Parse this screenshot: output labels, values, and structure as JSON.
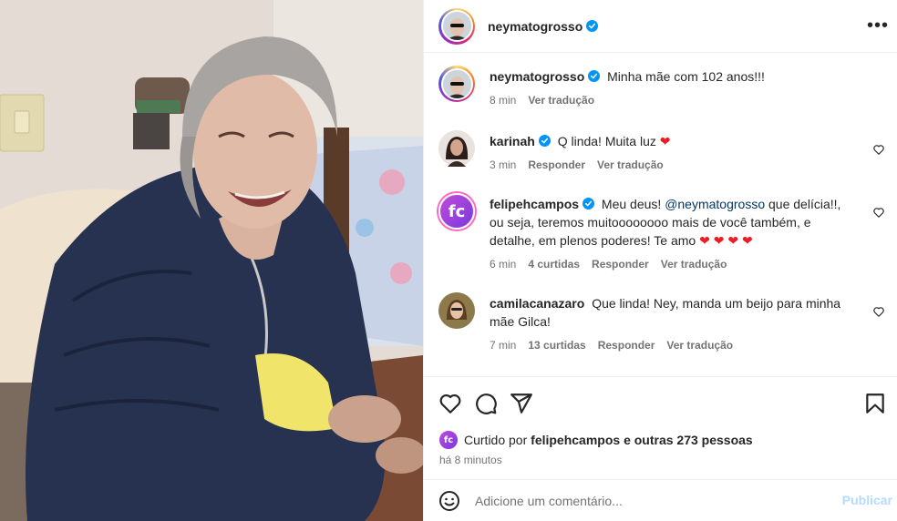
{
  "post": {
    "username": "neymatogrosso",
    "verified": true
  },
  "caption": {
    "username": "neymatogrosso",
    "text": "Minha mãe com 102 anos!!!",
    "time": "8 min",
    "translate": "Ver tradução"
  },
  "comments": [
    {
      "username": "karinah",
      "verified": true,
      "parts": [
        "Q linda! Muita luz ",
        "❤"
      ],
      "time": "3 min",
      "likes": "",
      "reply": "Responder",
      "translate": "Ver tradução"
    },
    {
      "username": "felipehcampos",
      "verified": true,
      "line1_pre": "Meu deus! ",
      "mention": "@neymatogrosso",
      "line1_post": " que delícia!!,",
      "line2": "ou seja, teremos muitoooooooo mais de você também, e",
      "line3": "detalhe, em plenos poderes! Te amo ",
      "hearts": "❤ ❤ ❤ ❤",
      "time": "6 min",
      "likes": "4 curtidas",
      "reply": "Responder",
      "translate": "Ver tradução"
    },
    {
      "username": "camilacanazaro",
      "verified": false,
      "line1": "Que linda! Ney, manda um beijo para minha",
      "line2": "mãe Gilca!",
      "time": "7 min",
      "likes": "13 curtidas",
      "reply": "Responder",
      "translate": "Ver tradução"
    }
  ],
  "likes": {
    "prefix": "Curtido por ",
    "user": "felipehcampos",
    "suffix": " e outras 273 pessoas"
  },
  "posted_ago": "há 8 minutos",
  "add_comment": {
    "placeholder": "Adicione um comentário...",
    "publish": "Publicar"
  },
  "icons": {
    "like": "heart-icon",
    "comment": "comment-icon",
    "share": "share-icon",
    "save": "bookmark-icon",
    "emoji": "emoji-icon",
    "more": "more-icon",
    "verified": "verified-badge-icon"
  },
  "colors": {
    "verified": "#0095f6",
    "mention": "#00376b",
    "publish_disabled": "#b3dbff",
    "heart": "#ed1c24"
  }
}
